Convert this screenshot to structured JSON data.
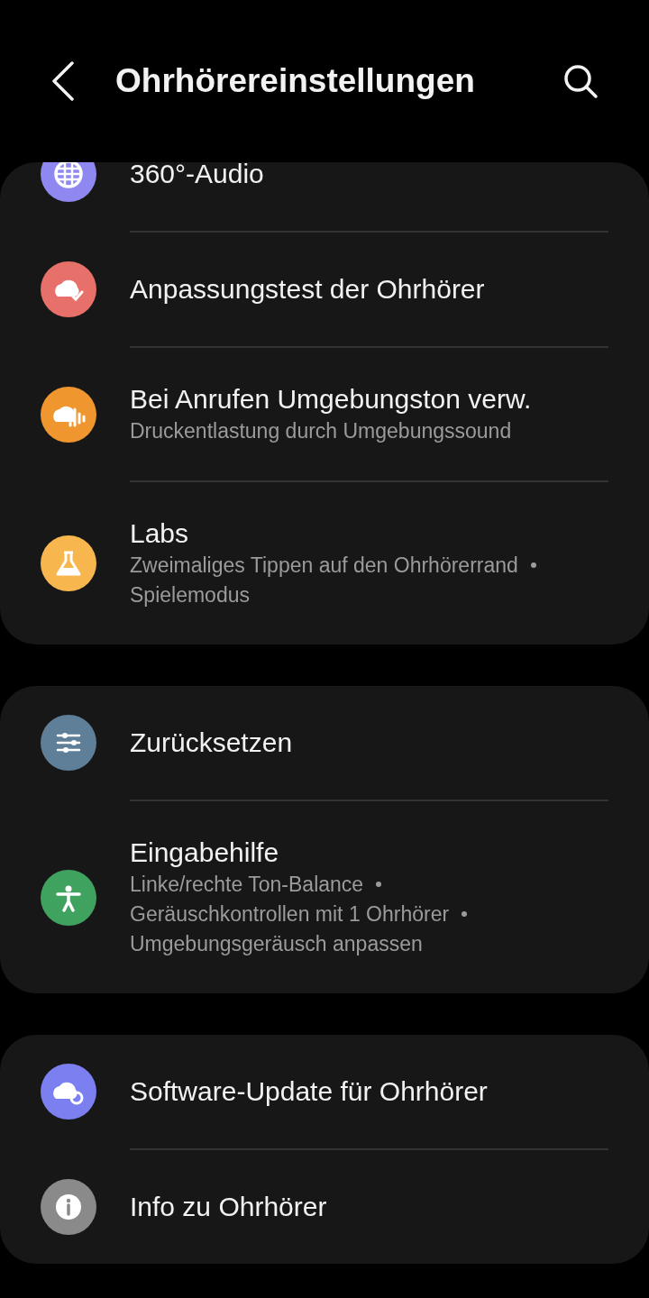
{
  "header": {
    "title": "Ohrhörereinstellungen"
  },
  "groups": [
    {
      "items": [
        {
          "kind": "globe",
          "color": "#8f88f0",
          "title": "360°-Audio"
        },
        {
          "kind": "check",
          "color": "#e8706a",
          "title": "Anpassungstest der Ohrhörer"
        },
        {
          "kind": "ambient",
          "color": "#f0962e",
          "title": "Bei Anrufen Umgebungston verw.",
          "subtitle": [
            "Druckentlastung durch Umgebungssound"
          ]
        },
        {
          "kind": "flask",
          "color": "#f7b74e",
          "title": "Labs",
          "subtitle": [
            "Zweimaliges Tippen auf den Ohrhörerrand",
            "Spielemodus"
          ]
        }
      ]
    },
    {
      "items": [
        {
          "kind": "sliders",
          "color": "#5f7f99",
          "title": "Zurücksetzen"
        },
        {
          "kind": "person",
          "color": "#3fa35f",
          "title": "Eingabehilfe",
          "subtitle": [
            "Linke/rechte Ton-Balance",
            "Geräuschkontrollen mit 1 Ohrhörer",
            "Umgebungsgeräusch anpassen"
          ]
        }
      ]
    },
    {
      "items": [
        {
          "kind": "update",
          "color": "#7b7ff0",
          "title": "Software-Update für Ohrhörer"
        },
        {
          "kind": "info",
          "color": "#8a8a8a",
          "title": "Info zu Ohrhörer"
        }
      ]
    }
  ]
}
